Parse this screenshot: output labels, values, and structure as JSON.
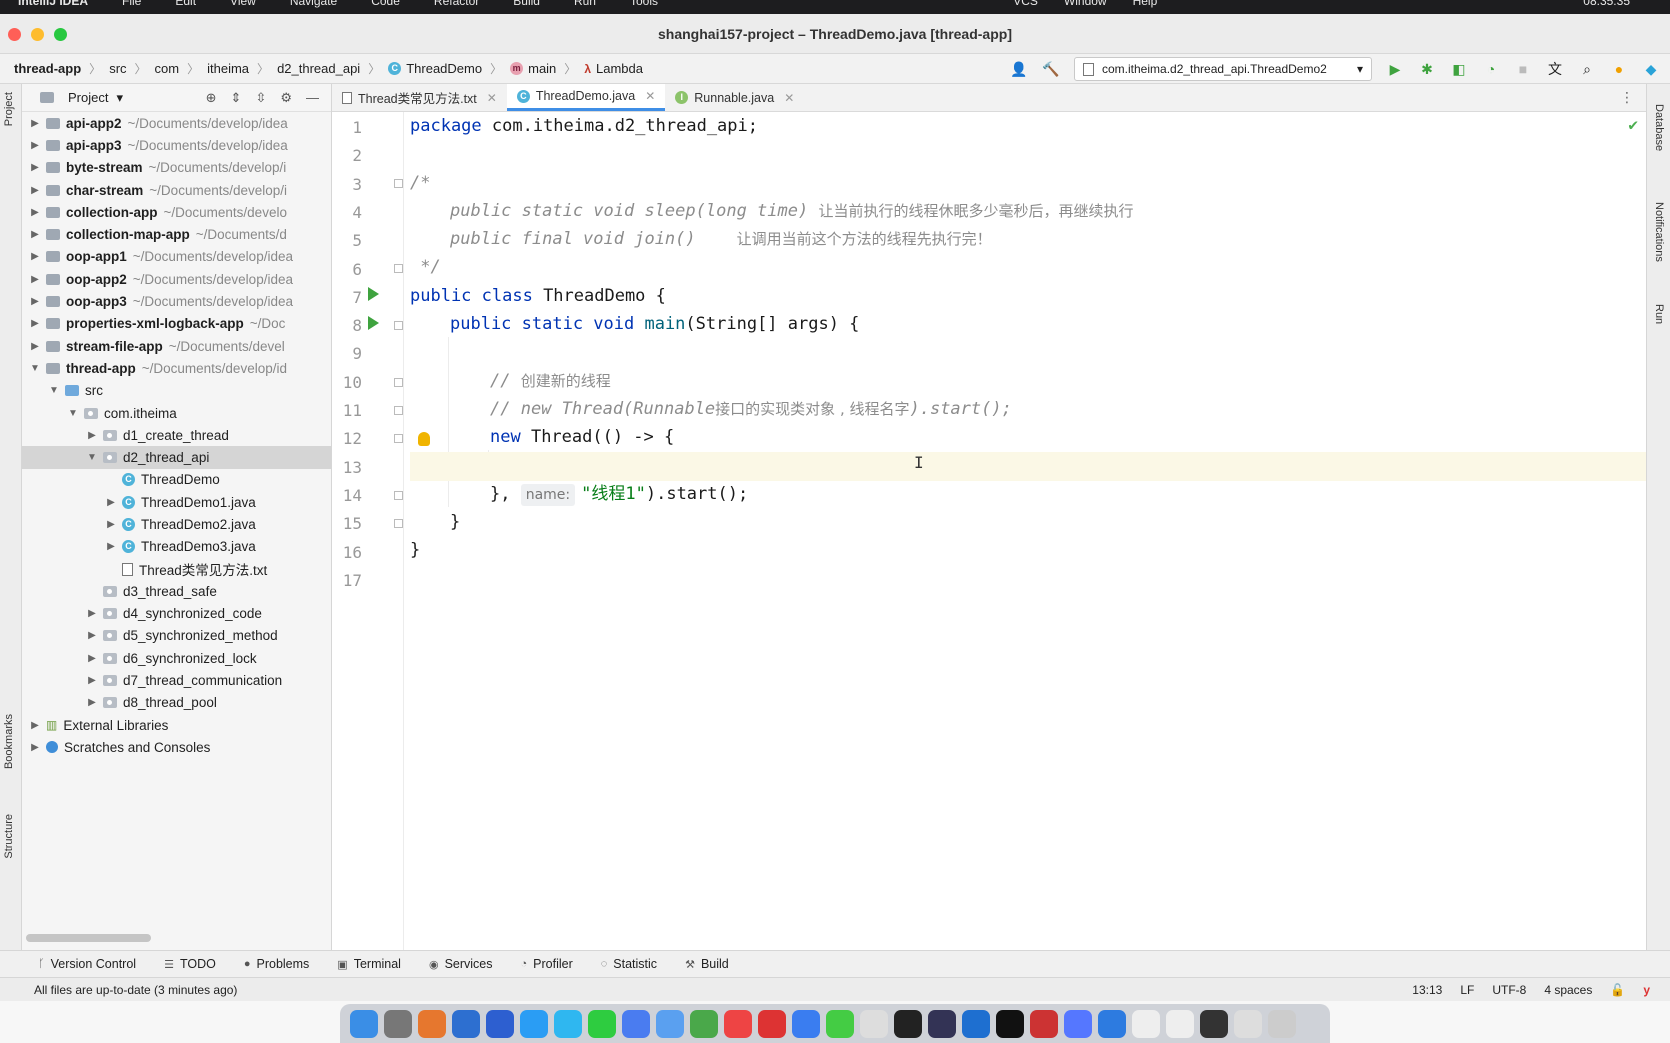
{
  "mac_menu": {
    "app": "IntelliJ IDEA",
    "items": [
      "File",
      "Edit",
      "View",
      "Navigate",
      "Code",
      "Refactor",
      "Build",
      "Run",
      "Tools"
    ],
    "right_items": [
      "VCS",
      "Window",
      "Help"
    ],
    "clock": "08:35:35"
  },
  "window": {
    "title": "shanghai157-project – ThreadDemo.java [thread-app]"
  },
  "breadcrumb": [
    "thread-app",
    "src",
    "com",
    "itheima",
    "d2_thread_api",
    "ThreadDemo",
    "main",
    "Lambda"
  ],
  "run_config": "com.itheima.d2_thread_api.ThreadDemo2",
  "project_panel": {
    "title": "Project",
    "tree": [
      {
        "indent": 0,
        "arrow": "▶",
        "kind": "module",
        "name": "api-app2",
        "path": "~/Documents/develop/idea"
      },
      {
        "indent": 0,
        "arrow": "▶",
        "kind": "module",
        "name": "api-app3",
        "path": "~/Documents/develop/idea"
      },
      {
        "indent": 0,
        "arrow": "▶",
        "kind": "module",
        "name": "byte-stream",
        "path": "~/Documents/develop/i"
      },
      {
        "indent": 0,
        "arrow": "▶",
        "kind": "module",
        "name": "char-stream",
        "path": "~/Documents/develop/i"
      },
      {
        "indent": 0,
        "arrow": "▶",
        "kind": "module",
        "name": "collection-app",
        "path": "~/Documents/develo"
      },
      {
        "indent": 0,
        "arrow": "▶",
        "kind": "module",
        "name": "collection-map-app",
        "path": "~/Documents/d"
      },
      {
        "indent": 0,
        "arrow": "▶",
        "kind": "module",
        "name": "oop-app1",
        "path": "~/Documents/develop/idea"
      },
      {
        "indent": 0,
        "arrow": "▶",
        "kind": "module",
        "name": "oop-app2",
        "path": "~/Documents/develop/idea"
      },
      {
        "indent": 0,
        "arrow": "▶",
        "kind": "module",
        "name": "oop-app3",
        "path": "~/Documents/develop/idea"
      },
      {
        "indent": 0,
        "arrow": "▶",
        "kind": "module",
        "name": "properties-xml-logback-app",
        "path": "~/Doc"
      },
      {
        "indent": 0,
        "arrow": "▶",
        "kind": "module",
        "name": "stream-file-app",
        "path": "~/Documents/devel"
      },
      {
        "indent": 0,
        "arrow": "▼",
        "kind": "module",
        "name": "thread-app",
        "path": "~/Documents/develop/id"
      },
      {
        "indent": 1,
        "arrow": "▼",
        "kind": "src",
        "name": "src",
        "path": ""
      },
      {
        "indent": 2,
        "arrow": "▼",
        "kind": "pkg",
        "name": "com.itheima",
        "path": ""
      },
      {
        "indent": 3,
        "arrow": "▶",
        "kind": "pkg",
        "name": "d1_create_thread",
        "path": ""
      },
      {
        "indent": 3,
        "arrow": "▼",
        "kind": "pkg",
        "name": "d2_thread_api",
        "path": "",
        "selected": true
      },
      {
        "indent": 4,
        "arrow": "",
        "kind": "class",
        "name": "ThreadDemo",
        "path": ""
      },
      {
        "indent": 4,
        "arrow": "▶",
        "kind": "class",
        "name": "ThreadDemo1.java",
        "path": ""
      },
      {
        "indent": 4,
        "arrow": "▶",
        "kind": "class",
        "name": "ThreadDemo2.java",
        "path": ""
      },
      {
        "indent": 4,
        "arrow": "▶",
        "kind": "class",
        "name": "ThreadDemo3.java",
        "path": ""
      },
      {
        "indent": 4,
        "arrow": "",
        "kind": "txt",
        "name": "Thread类常见方法.txt",
        "path": ""
      },
      {
        "indent": 3,
        "arrow": "",
        "kind": "pkg",
        "name": "d3_thread_safe",
        "path": ""
      },
      {
        "indent": 3,
        "arrow": "▶",
        "kind": "pkg",
        "name": "d4_synchronized_code",
        "path": ""
      },
      {
        "indent": 3,
        "arrow": "▶",
        "kind": "pkg",
        "name": "d5_synchronized_method",
        "path": ""
      },
      {
        "indent": 3,
        "arrow": "▶",
        "kind": "pkg",
        "name": "d6_synchronized_lock",
        "path": ""
      },
      {
        "indent": 3,
        "arrow": "▶",
        "kind": "pkg",
        "name": "d7_thread_communication",
        "path": ""
      },
      {
        "indent": 3,
        "arrow": "▶",
        "kind": "pkg",
        "name": "d8_thread_pool",
        "path": ""
      },
      {
        "indent": 0,
        "arrow": "▶",
        "kind": "lib",
        "name": "External Libraries",
        "path": ""
      },
      {
        "indent": 0,
        "arrow": "▶",
        "kind": "scratch",
        "name": "Scratches and Consoles",
        "path": ""
      }
    ]
  },
  "left_strip": {
    "project": "Project",
    "bookmarks": "Bookmarks",
    "structure": "Structure"
  },
  "right_strip": {
    "database": "Database",
    "notifications": "Notifications",
    "run": "Run"
  },
  "editor_tabs": [
    {
      "label": "Thread类常见方法.txt",
      "kind": "txt",
      "active": false
    },
    {
      "label": "ThreadDemo.java",
      "kind": "class",
      "active": true
    },
    {
      "label": "Runnable.java",
      "kind": "interface",
      "active": false
    }
  ],
  "code": {
    "line_numbers": [
      "1",
      "2",
      "3",
      "4",
      "5",
      "6",
      "7",
      "8",
      "9",
      "10",
      "11",
      "12",
      "13",
      "14",
      "15",
      "16",
      "17"
    ],
    "current_line": "13",
    "l1_kw": "package",
    "l1_rest": " com.itheima.d2_thread_api;",
    "l3": "/*",
    "l4_code": "public static void sleep(long time) ",
    "l4_cn": "让当前执行的线程休眠多少毫秒后，再继续执行",
    "l5_code": "public final void join()    ",
    "l5_cn": "让调用当前这个方法的线程先执行完！",
    "l6": " */",
    "l7_kw": "public class",
    "l7_rest": " ThreadDemo {",
    "l8_kw": "public static void",
    "l8_fn": " main",
    "l8_rest": "(String[] args) {",
    "l10_a": "// ",
    "l10_cn": "创建新的线程",
    "l11_a": "// new Thread(Runnable",
    "l11_cn": "接口的实现类对象 , 线程名字",
    "l11_b": ").start();",
    "l12_kw": "new",
    "l12_rest": " Thread(() -> {",
    "l14_a": "}, ",
    "l14_hint": "name:",
    "l14_str": "\"线程1\"",
    "l14_b": ").start();",
    "l15": "}",
    "l16": "}"
  },
  "bottom_tools": [
    "Version Control",
    "TODO",
    "Problems",
    "Terminal",
    "Services",
    "Profiler",
    "Statistic",
    "Build"
  ],
  "status": {
    "message": "All files are up-to-date (3 minutes ago)",
    "position": "13:13",
    "line_sep": "LF",
    "encoding": "UTF-8",
    "indent": "4 spaces"
  },
  "colors": {
    "accent": "#3f8ee6",
    "run_green": "#3fa33f",
    "keyword": "#0033b3",
    "string": "#067d17"
  }
}
